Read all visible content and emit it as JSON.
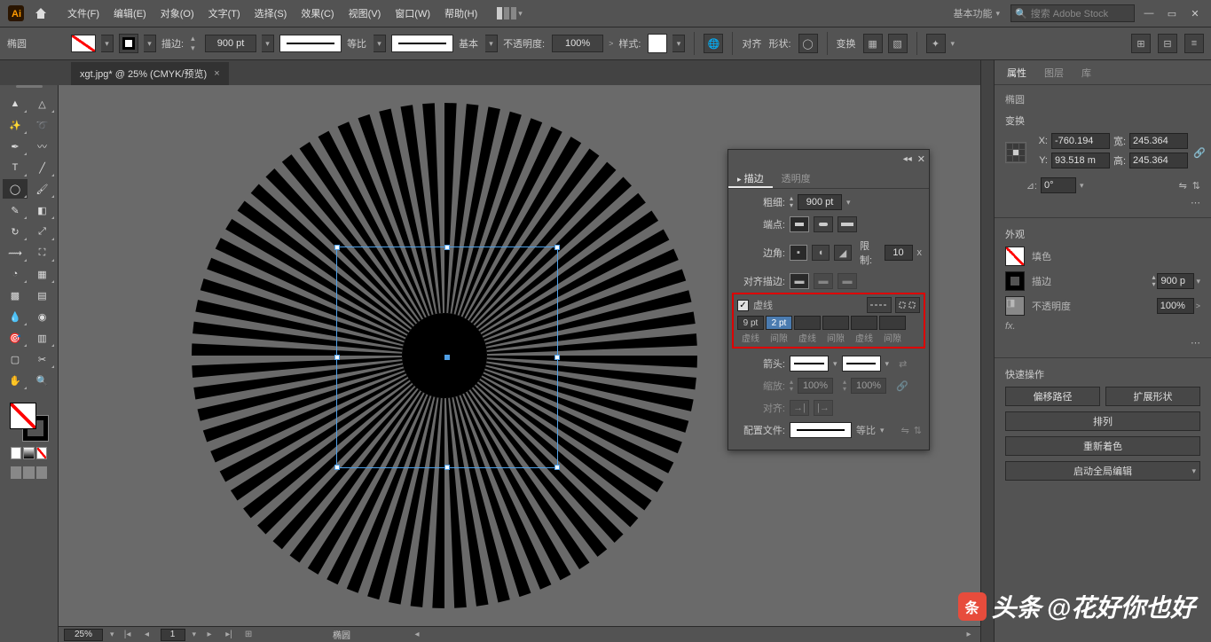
{
  "menubar": {
    "items": [
      "文件(F)",
      "编辑(E)",
      "对象(O)",
      "文字(T)",
      "选择(S)",
      "效果(C)",
      "视图(V)",
      "窗口(W)",
      "帮助(H)"
    ],
    "workspace_label": "基本功能",
    "search_placeholder": "搜索 Adobe Stock"
  },
  "controlbar": {
    "shape_label": "椭圆",
    "stroke_label": "描边:",
    "stroke_weight": "900 pt",
    "stroke_style_label": "等比",
    "brush_style_label": "基本",
    "opacity_label": "不透明度:",
    "opacity_value": "100%",
    "style_label": "样式:",
    "align_label": "对齐",
    "shape_btn": "形状:",
    "transform_label": "变换"
  },
  "doctab": {
    "title": "xgt.jpg* @ 25% (CMYK/预览)"
  },
  "stroke_panel": {
    "tab_stroke": "描边",
    "tab_opacity": "透明度",
    "weight_label": "粗细:",
    "weight_value": "900 pt",
    "cap_label": "端点:",
    "corner_label": "边角:",
    "limit_label": "限制:",
    "limit_value": "10",
    "limit_unit": "x",
    "align_label": "对齐描边:",
    "dash_label": "虚线",
    "dash_values": [
      "9 pt",
      "2 pt",
      "",
      "",
      "",
      ""
    ],
    "dash_col_labels": [
      "虚线",
      "间隙",
      "虚线",
      "间隙",
      "虚线",
      "间隙"
    ],
    "arrow_label": "箭头:",
    "scale_label": "缩放:",
    "scale_values": [
      "100%",
      "100%"
    ],
    "align_arrow_label": "对齐:",
    "profile_label": "配置文件:",
    "profile_value": "等比"
  },
  "properties": {
    "tabs": [
      "属性",
      "图层",
      "库"
    ],
    "shape_name": "椭圆",
    "transform_title": "变换",
    "x_label": "X:",
    "x_value": "-760.194",
    "y_label": "Y:",
    "y_value": "93.518 m",
    "w_label": "宽:",
    "w_value": "245.364",
    "h_label": "高:",
    "h_value": "245.364",
    "angle_value": "0°",
    "appearance_title": "外观",
    "fill_label": "填色",
    "stroke_label": "描边",
    "stroke_weight": "900 p",
    "opacity_label": "不透明度",
    "opacity_value": "100%",
    "fx_label": "fx.",
    "quick_title": "快速操作",
    "btn_offset": "偏移路径",
    "btn_expand": "扩展形状",
    "btn_arrange": "排列",
    "btn_recolor": "重新着色",
    "btn_global_edit": "启动全局编辑"
  },
  "statusbar": {
    "zoom": "25%",
    "page": "1",
    "shape": "椭圆"
  },
  "watermark": {
    "brand": "头条",
    "author": "@花好你也好"
  }
}
